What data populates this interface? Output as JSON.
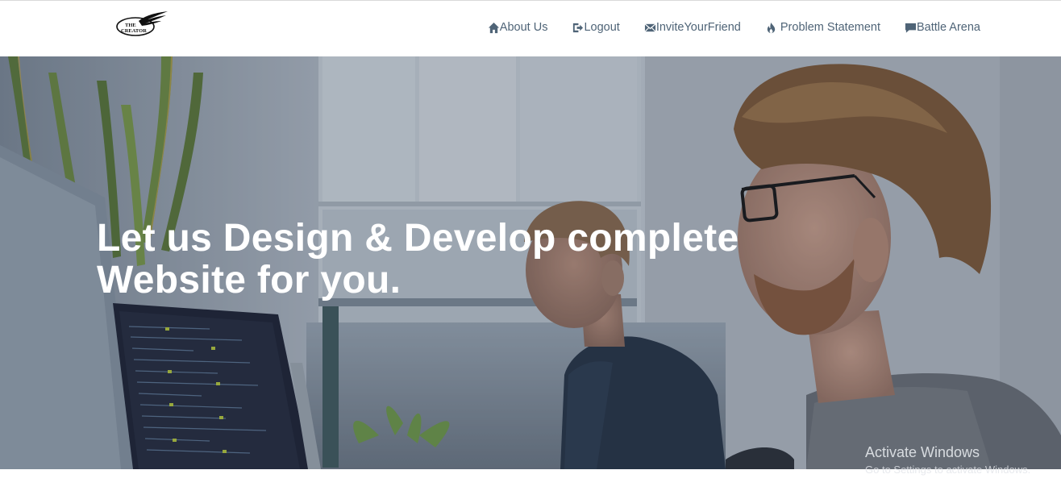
{
  "brand": {
    "logo_text_line1": "THE",
    "logo_text_line2": "CREATOR"
  },
  "nav": {
    "items": [
      {
        "label": "About Us",
        "icon": "home-icon"
      },
      {
        "label": "Logout",
        "icon": "logout-icon"
      },
      {
        "label": "InviteYourFriend",
        "icon": "envelope-icon"
      },
      {
        "label": "Problem Statement",
        "icon": "fire-icon"
      },
      {
        "label": "Battle Arena",
        "icon": "chat-bubble-icon"
      }
    ]
  },
  "hero": {
    "heading_line1": "Let us Design & Develop complete",
    "heading_line2": "Website for you."
  },
  "watermark": {
    "title": "Activate Windows",
    "subtitle": "Go to Settings to activate Windows."
  },
  "colors": {
    "nav_text": "#4f6477",
    "hero_text": "#ffffff"
  }
}
